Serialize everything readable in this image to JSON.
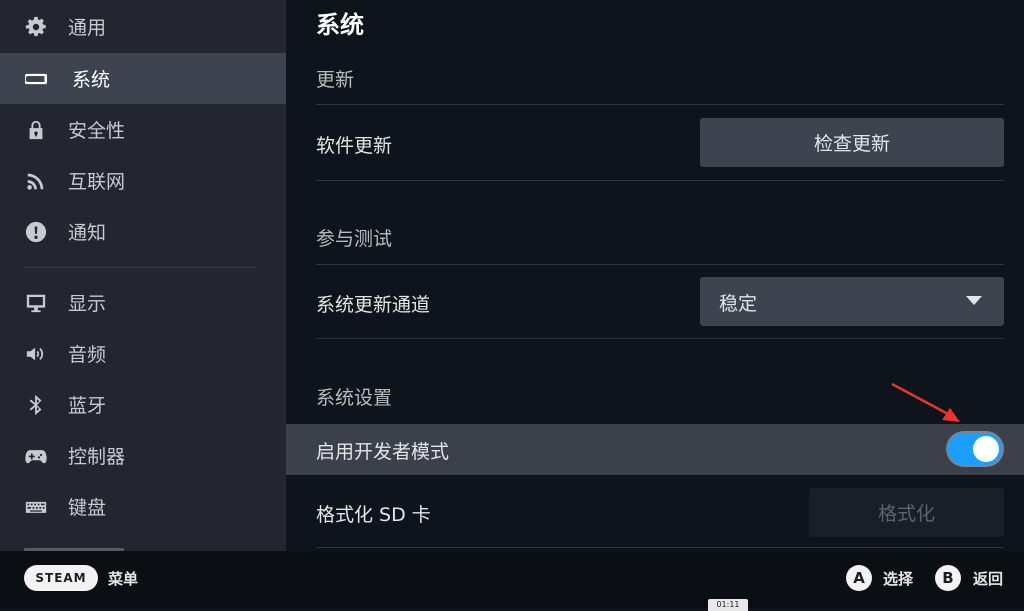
{
  "sidebar": {
    "items": [
      {
        "label": "通用",
        "icon": "gear-icon"
      },
      {
        "label": "系统",
        "icon": "system-device-icon"
      },
      {
        "label": "安全性",
        "icon": "lock-icon"
      },
      {
        "label": "互联网",
        "icon": "wifi-icon"
      },
      {
        "label": "通知",
        "icon": "alert-icon"
      },
      {
        "label": "显示",
        "icon": "monitor-icon"
      },
      {
        "label": "音频",
        "icon": "speaker-icon"
      },
      {
        "label": "蓝牙",
        "icon": "bluetooth-icon"
      },
      {
        "label": "控制器",
        "icon": "gamepad-icon"
      },
      {
        "label": "键盘",
        "icon": "keyboard-icon"
      }
    ],
    "selected": "系统"
  },
  "main": {
    "title": "系统",
    "update_section": "更新",
    "software_update_label": "软件更新",
    "check_update_button": "检查更新",
    "beta_section": "参与测试",
    "channel_label": "系统更新通道",
    "channel_value": "稳定",
    "settings_section": "系统设置",
    "dev_mode_label": "启用开发者模式",
    "dev_mode_enabled": true,
    "format_sd_label": "格式化 SD 卡",
    "format_button": "格式化"
  },
  "footer": {
    "steam_label": "STEAM",
    "menu_label": "菜单",
    "a_glyph": "A",
    "a_label": "选择",
    "b_glyph": "B",
    "b_label": "返回",
    "clock": "01:11"
  },
  "colors": {
    "accent": "#1a9fff",
    "annotation_arrow": "#e8342a",
    "sidebar_bg": "#23262e",
    "main_bg": "#0e141b"
  }
}
